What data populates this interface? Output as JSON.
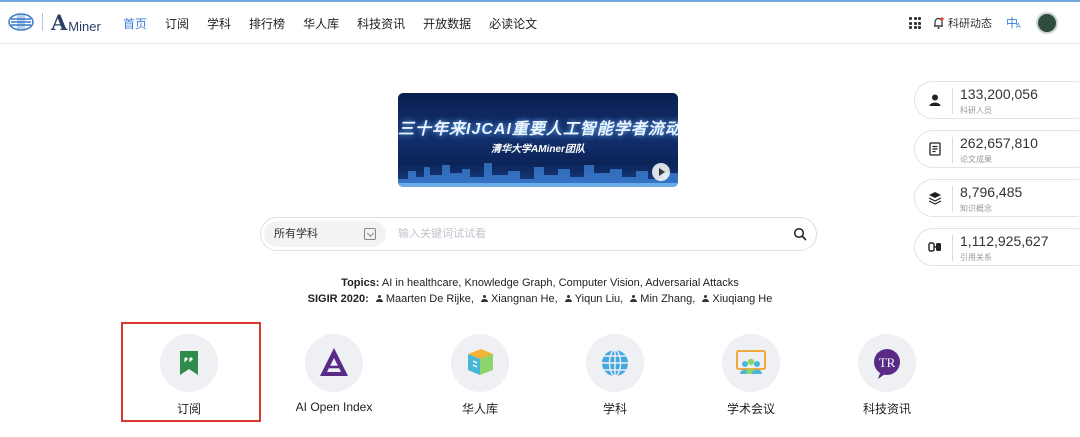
{
  "header": {
    "logo_text_a": "A",
    "logo_text_rest": "Miner",
    "nav": [
      {
        "label": "首页",
        "active": true
      },
      {
        "label": "订阅"
      },
      {
        "label": "学科"
      },
      {
        "label": "排行榜"
      },
      {
        "label": "华人库"
      },
      {
        "label": "科技资讯"
      },
      {
        "label": "开放数据"
      },
      {
        "label": "必读论文"
      }
    ],
    "research_updates": "科研动态",
    "lang": "中",
    "lang_sub": "A"
  },
  "banner": {
    "title": "三十年来IJCAI重要人工智能学者流动态势",
    "subtitle": "清华大学AMiner团队"
  },
  "search": {
    "scope": "所有学科",
    "placeholder": "输入关键词试试看"
  },
  "topics": {
    "topics_label": "Topics:",
    "topics_text": "AI in healthcare, Knowledge Graph, Computer Vision, Adversarial Attacks",
    "sigir_label": "SIGIR 2020:",
    "people": [
      "Maarten De Rijke,",
      "Xiangnan He,",
      "Yiqun Liu,",
      "Min Zhang,",
      "Xiuqiang He"
    ]
  },
  "stats": [
    {
      "value": "133,200,056",
      "label": "科研人员",
      "icon": "person-icon"
    },
    {
      "value": "262,657,810",
      "label": "论文成果",
      "icon": "paper-icon"
    },
    {
      "value": "8,796,485",
      "label": "知识概念",
      "icon": "layers-icon"
    },
    {
      "value": "1,112,925,627",
      "label": "引用关系",
      "icon": "quote-icon"
    }
  ],
  "tiles": [
    {
      "label": "订阅",
      "icon": "bookmark-icon"
    },
    {
      "label": "AI Open Index",
      "icon": "ai-triangle-icon"
    },
    {
      "label": "华人库",
      "icon": "book-icon"
    },
    {
      "label": "学科",
      "icon": "globe-icon"
    },
    {
      "label": "学术会议",
      "icon": "conference-icon"
    },
    {
      "label": "科技资讯",
      "icon": "tr-icon"
    }
  ],
  "colors": {
    "accent": "#3d7ee0",
    "highlight_border": "#d9392e"
  }
}
